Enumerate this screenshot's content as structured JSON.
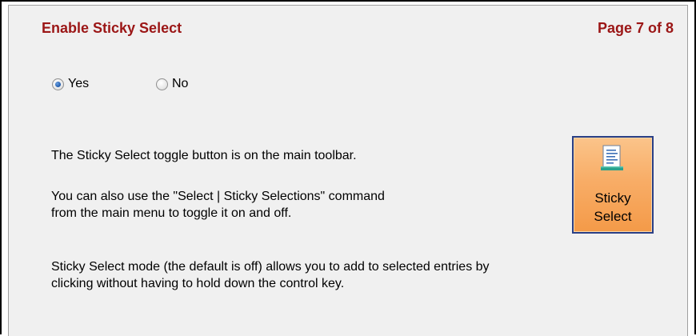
{
  "header": {
    "title": "Enable Sticky Select",
    "page_indicator": "Page 7 of 8"
  },
  "options": {
    "yes_label": "Yes",
    "no_label": "No",
    "selected": "Yes"
  },
  "content": {
    "line1": "The Sticky Select toggle button is on the main toolbar.",
    "line2": "You can also use the \"Select | Sticky Selections\" command",
    "line3": "from the main menu to toggle it on and off.",
    "line4": "Sticky Select mode (the default is off) allows you to add to selected entries by",
    "line5": "clicking without having to hold down the control key."
  },
  "toolbar_button": {
    "label_line1": "Sticky",
    "label_line2": "Select",
    "icon": "document-icon"
  },
  "colors": {
    "title": "#9b1616",
    "panel_bg": "#f0f0f0",
    "button_bg": "#f8ad67",
    "button_border": "#2a3f86"
  }
}
